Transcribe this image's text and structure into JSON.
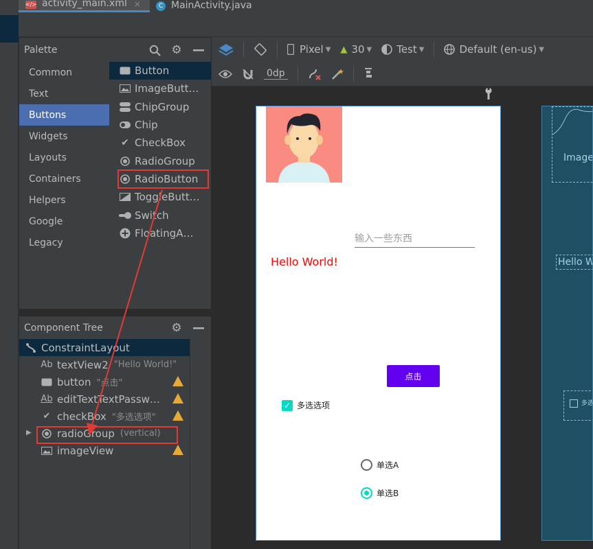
{
  "tabs": [
    {
      "label": "activity_main.xml",
      "active": true
    },
    {
      "label": "MainActivity.java",
      "active": false
    }
  ],
  "palette": {
    "title": "Palette",
    "categories": [
      "Common",
      "Text",
      "Buttons",
      "Widgets",
      "Layouts",
      "Containers",
      "Helpers",
      "Google",
      "Legacy"
    ],
    "selected_category": "Buttons",
    "items": [
      {
        "label": "Button",
        "icon": "button-icon"
      },
      {
        "label": "ImageButt…",
        "icon": "image-icon"
      },
      {
        "label": "ChipGroup",
        "icon": "chip-group-icon"
      },
      {
        "label": "Chip",
        "icon": "chip-icon"
      },
      {
        "label": "CheckBox",
        "icon": "check-icon"
      },
      {
        "label": "RadioGroup",
        "icon": "radio-icon"
      },
      {
        "label": "RadioButton",
        "icon": "radio-icon"
      },
      {
        "label": "ToggleButt…",
        "icon": "toggle-icon"
      },
      {
        "label": "Switch",
        "icon": "switch-icon"
      },
      {
        "label": "FloatingA…",
        "icon": "plus-circle-icon"
      }
    ]
  },
  "design_toolbar": {
    "device": "Pixel",
    "api": "30",
    "theme": "Test",
    "locale": "Default (en-us)",
    "margin": "0dp"
  },
  "component_tree": {
    "title": "Component Tree",
    "root": "ConstraintLayout",
    "nodes": [
      {
        "prefix": "Ab",
        "name": "textView2",
        "desc": "\"Hello World!\"",
        "warn": false
      },
      {
        "prefix": "",
        "name": "button",
        "desc": "\"点击\"",
        "warn": true
      },
      {
        "prefix": "Ab",
        "name": "editTextTextPassw…",
        "desc": "",
        "warn": true
      },
      {
        "prefix": "",
        "name": "checkBox",
        "desc": "\"多选选项\"",
        "warn": true
      },
      {
        "prefix": "",
        "name": "radioGroup",
        "desc": "(vertical)",
        "warn": false
      },
      {
        "prefix": "",
        "name": "imageView",
        "desc": "",
        "warn": true
      }
    ]
  },
  "preview": {
    "edit_hint": "输入一些东西",
    "hello_text": "Hello World!",
    "button_label": "点击",
    "checkbox_label": "多选选项",
    "radio_a": "单选A",
    "radio_b": "单选B"
  },
  "blueprint": {
    "image_label": "Image",
    "hello_label": "Hello Wo",
    "checkbox_label": "多选"
  },
  "colors": {
    "accent_red": "#e53935",
    "hello_red": "#ff0000",
    "button_purple": "#6200ee",
    "teal": "#03dac5"
  }
}
